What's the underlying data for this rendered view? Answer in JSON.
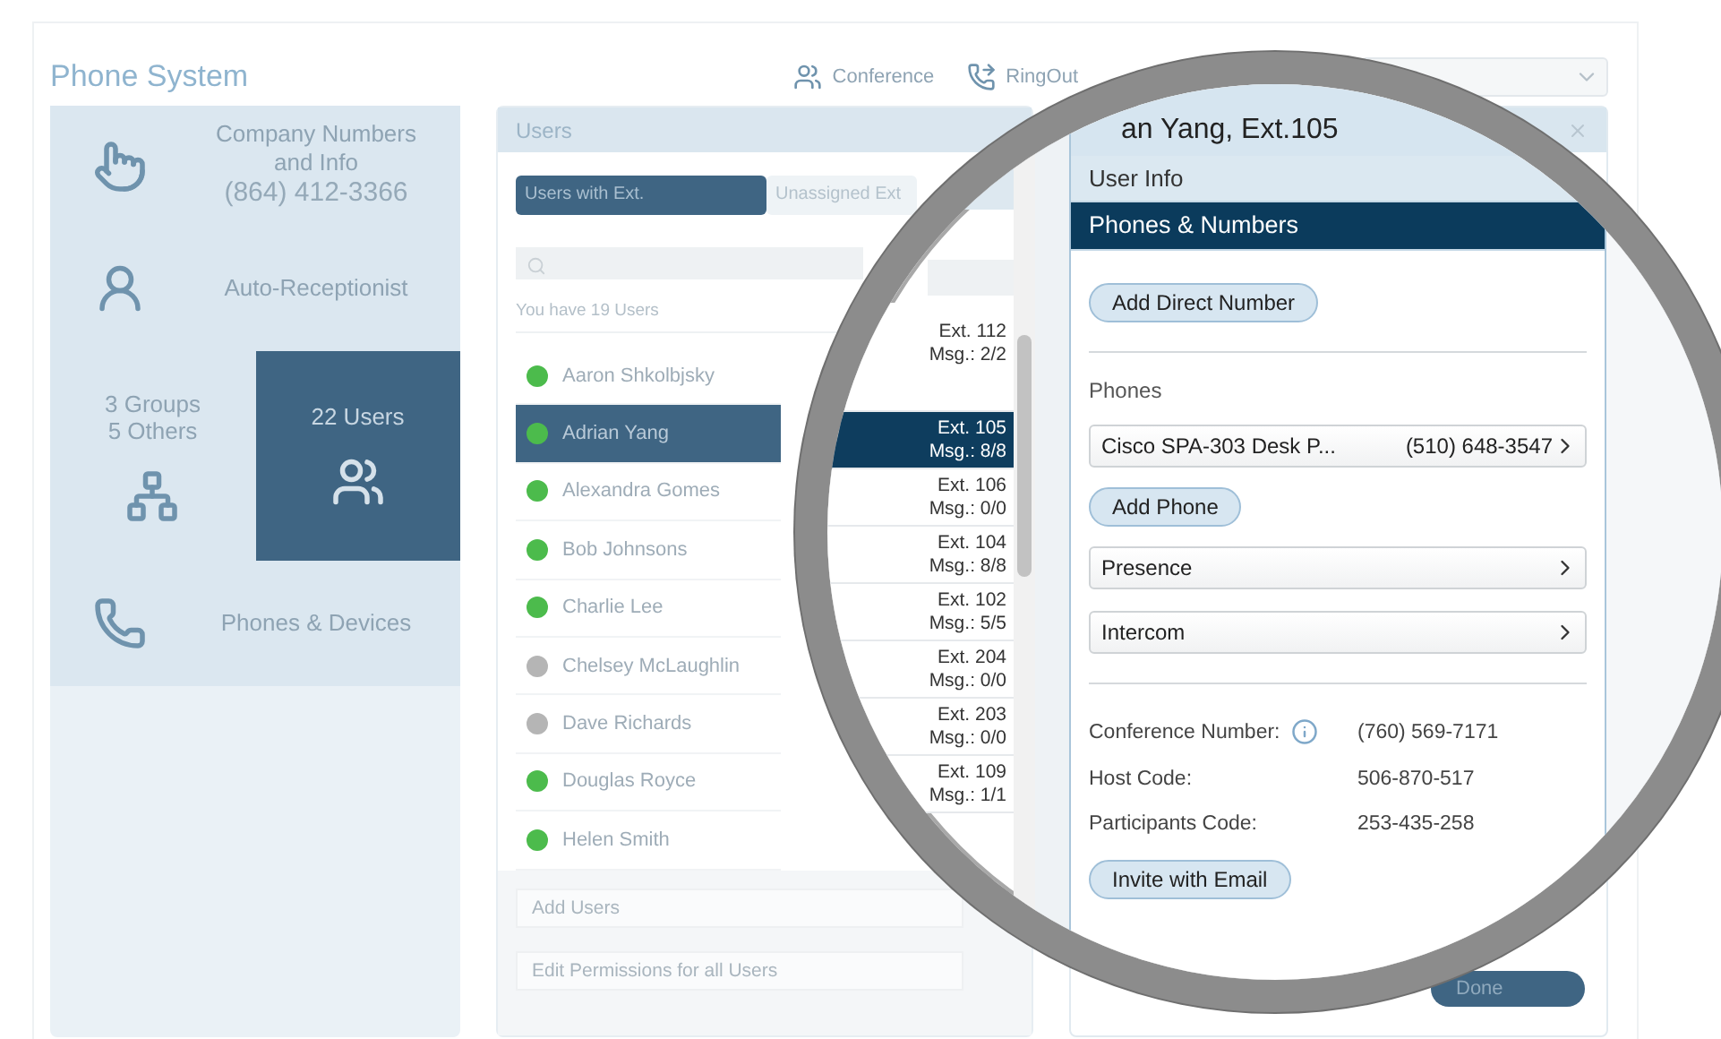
{
  "app": {
    "title": "Phone System"
  },
  "toolbar": [
    {
      "label": "Conference"
    },
    {
      "label": "RingOut"
    }
  ],
  "nav": [
    {
      "kind": "item",
      "title": "Company Numbers and Info",
      "subtitle": "(864) 412-3366"
    },
    {
      "kind": "item",
      "title": "Auto-Receptionist"
    },
    {
      "kind": "split",
      "tiles": [
        {
          "title": "3 Groups",
          "subtitle": "5 Others",
          "selected": false
        },
        {
          "title": "22 Users",
          "selected": true
        }
      ]
    },
    {
      "kind": "item",
      "title": "Phones & Devices"
    }
  ],
  "users_panel": {
    "title": "Users",
    "tabs": [
      {
        "label": "Users with Ext.",
        "selected": true
      },
      {
        "label": "Unassigned Ext",
        "selected": false
      }
    ],
    "count": "You have 19 Users",
    "users": [
      {
        "name": "Aaron Shkolbjsky",
        "ext": "Ext. 112",
        "msg": "Msg.: 2/2",
        "selected": false,
        "color": "#4cbb4c"
      },
      {
        "name": "Adrian Yang",
        "ext": "Ext. 105",
        "msg": "Msg.: 8/8",
        "selected": true,
        "color": "#4cbb4c"
      },
      {
        "name": "Alexandra Gomes",
        "ext": "Ext. 106",
        "msg": "Msg.: 0/0",
        "selected": false,
        "color": "#4cbb4c"
      },
      {
        "name": "Bob Johnsons",
        "ext": "Ext. 104",
        "msg": "Msg.: 8/8",
        "selected": false,
        "color": "#4cbb4c"
      },
      {
        "name": "Charlie Lee",
        "ext": "Ext. 102",
        "msg": "Msg.: 5/5",
        "selected": false,
        "color": "#4cbb4c"
      },
      {
        "name": "Chelsey McLaughlin",
        "ext": "Ext. 204",
        "msg": "Msg.: 0/0",
        "selected": false,
        "color": "#b5b5b5"
      },
      {
        "name": "Dave Richards",
        "ext": "Ext. 203",
        "msg": "Msg.: 0/0",
        "selected": false,
        "color": "#b5b5b5"
      },
      {
        "name": "Douglas Royce",
        "ext": "Ext. 109",
        "msg": "Msg.: 1/1",
        "selected": false,
        "color": "#4cbb4c"
      },
      {
        "name": "Helen Smith",
        "selected": false,
        "color": "#4cbb4c"
      }
    ],
    "actions": [
      "Add Users",
      "Edit Permissions for all Users"
    ]
  },
  "detail": {
    "title": "an Yang, Ext.105",
    "tabs": [
      {
        "label": "User Info",
        "selected": false
      },
      {
        "label": "Phones & Numbers",
        "selected": true
      }
    ],
    "add_number": "Add Direct Number",
    "phones_label": "Phones",
    "phones": [
      {
        "name": "Cisco SPA-303 Desk P...",
        "number": "(510) 648-3547"
      }
    ],
    "add_phone": "Add Phone",
    "settings": [
      "Presence",
      "Intercom"
    ],
    "info": [
      {
        "label": "Conference Number:",
        "value": "(760) 569-7171",
        "help": true
      },
      {
        "label": "Host Code:",
        "value": "506-870-517",
        "help": false
      },
      {
        "label": "Participants Code:",
        "value": "253-435-258",
        "help": false
      }
    ],
    "invite": "Invite with Email",
    "done": "Done"
  }
}
